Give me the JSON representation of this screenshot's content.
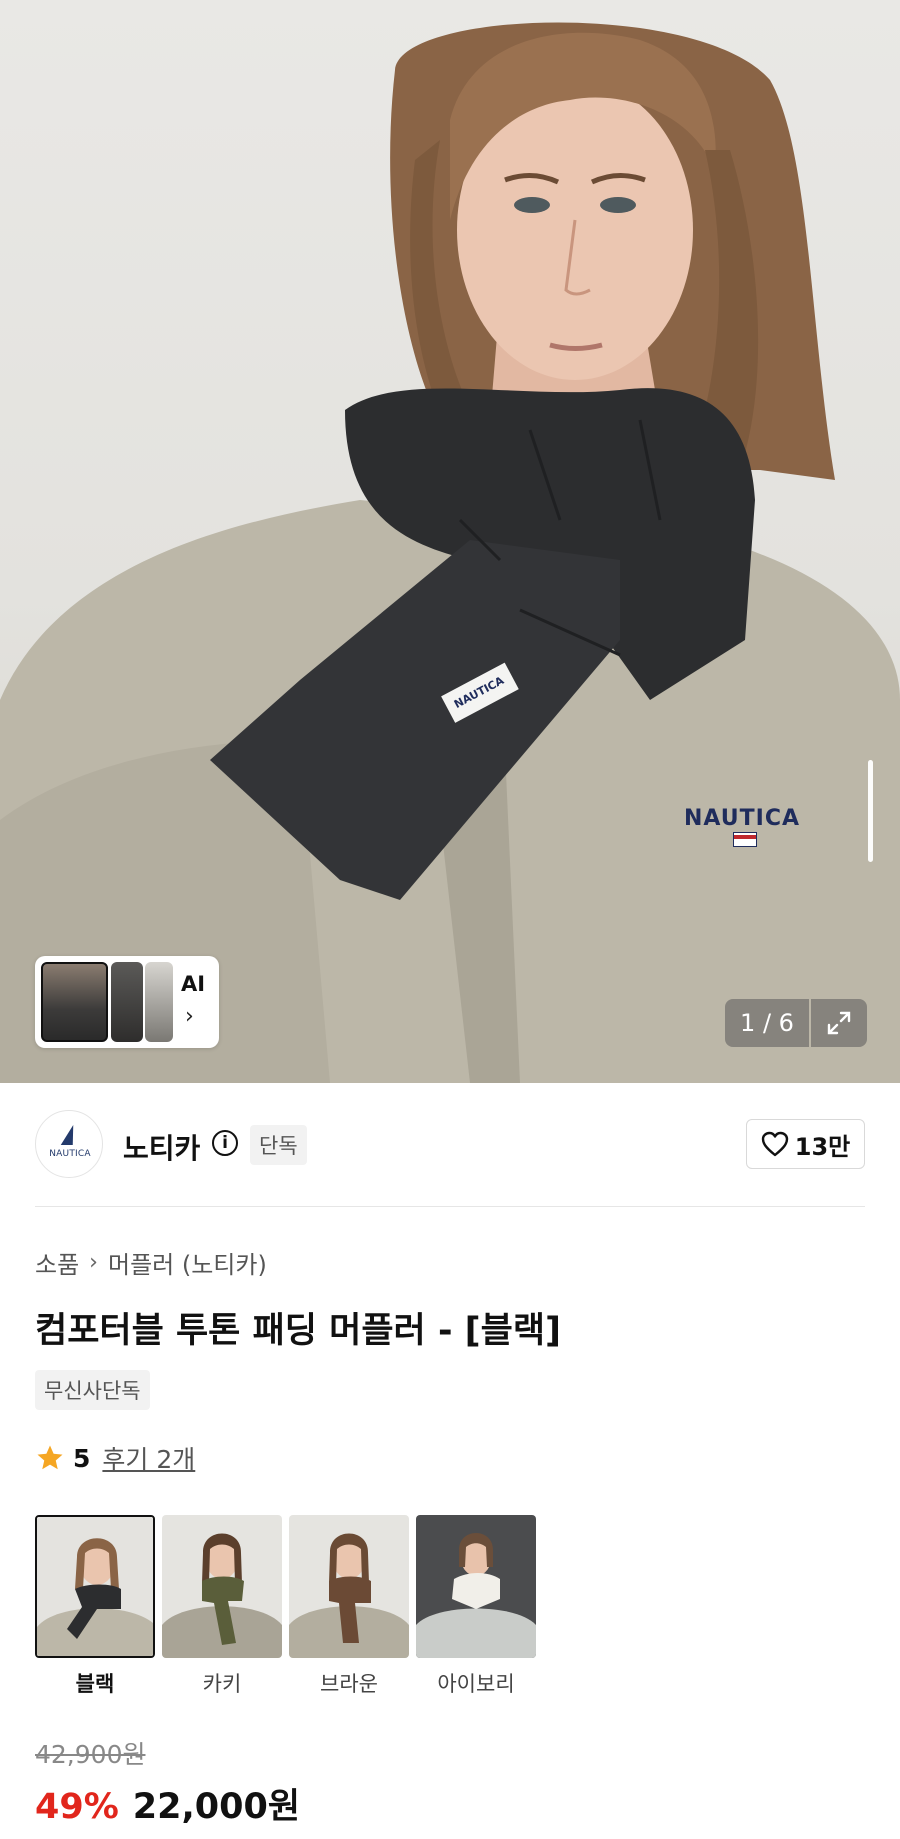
{
  "hero": {
    "ai_label": "AI",
    "pager": "1 / 6",
    "jacket_logo": "NAUTICA",
    "scarf_tag": "NAUTICA",
    "icons": [
      "chevron-right-icon",
      "expand-icon"
    ]
  },
  "brand": {
    "logo_text": "NAUTICA",
    "name": "노티카",
    "badge": "단독",
    "likes": "13만"
  },
  "breadcrumb": {
    "category": "소품",
    "subcategory": "머플러 (노티카)"
  },
  "product": {
    "title": "컴포터블 투톤 패딩 머플러 - [블랙]",
    "tag": "무신사단독",
    "rating": "5",
    "reviews": "후기 2개"
  },
  "colors": [
    {
      "label": "블랙",
      "selected": true,
      "scarf_color": "#2c2d2f"
    },
    {
      "label": "카키",
      "selected": false,
      "scarf_color": "#5a5e3a"
    },
    {
      "label": "브라운",
      "selected": false,
      "scarf_color": "#6b4a35"
    },
    {
      "label": "아이보리",
      "selected": false,
      "scarf_color": "#eeece6"
    }
  ],
  "price": {
    "original": "42,900원",
    "discount": "49%",
    "final": "22,000원"
  },
  "theme": {
    "accent_red": "#e1261c",
    "star_color": "#f5a623",
    "navy": "#1f2c5c"
  }
}
